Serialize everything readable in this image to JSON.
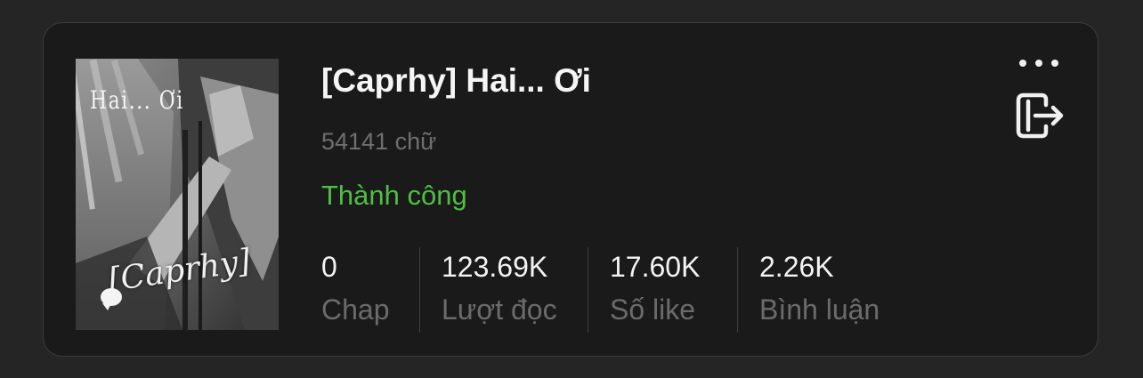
{
  "story": {
    "cover": {
      "title_text": "Hai... Ơi",
      "signature_text": "[Caprhy]"
    },
    "title": "[Caprhy] Hai... Ơi",
    "word_count": "54141 chữ",
    "status": "Thành công",
    "status_color": "#4fbf43",
    "stats": [
      {
        "value": "0",
        "label": "Chap"
      },
      {
        "value": "123.69K",
        "label": "Lượt đọc"
      },
      {
        "value": "17.60K",
        "label": "Số like"
      },
      {
        "value": "2.26K",
        "label": "Bình luận"
      }
    ]
  },
  "actions": {
    "more_icon": "more-horizontal-icon",
    "exit_icon": "exit-book-icon"
  }
}
